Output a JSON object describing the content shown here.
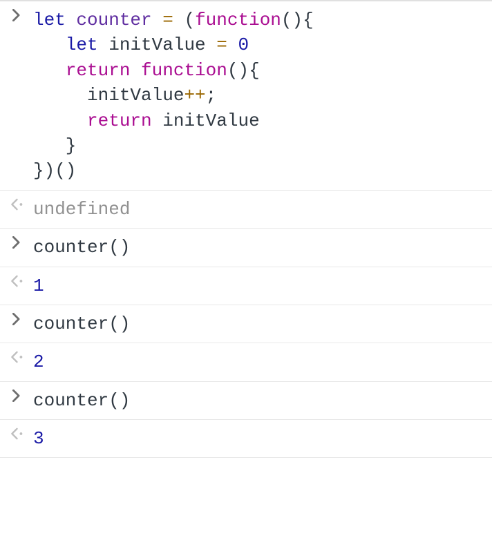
{
  "console": {
    "rows": [
      {
        "type": "input",
        "kind": "code-multiline",
        "tokens": [
          {
            "t": "let",
            "c": "tok-let"
          },
          {
            "t": " ",
            "c": "plain"
          },
          {
            "t": "counter",
            "c": "tok-var"
          },
          {
            "t": " ",
            "c": "plain"
          },
          {
            "t": "=",
            "c": "tok-op"
          },
          {
            "t": " ",
            "c": "plain"
          },
          {
            "t": "(",
            "c": "tok-paren"
          },
          {
            "t": "function",
            "c": "tok-kw"
          },
          {
            "t": "(){",
            "c": "tok-paren"
          },
          {
            "t": "\n   ",
            "c": "plain"
          },
          {
            "t": "let",
            "c": "tok-let"
          },
          {
            "t": " ",
            "c": "plain"
          },
          {
            "t": "initValue",
            "c": "tok-ident"
          },
          {
            "t": " ",
            "c": "plain"
          },
          {
            "t": "=",
            "c": "tok-op"
          },
          {
            "t": " ",
            "c": "plain"
          },
          {
            "t": "0",
            "c": "tok-num"
          },
          {
            "t": "\n   ",
            "c": "plain"
          },
          {
            "t": "return",
            "c": "tok-kw"
          },
          {
            "t": " ",
            "c": "plain"
          },
          {
            "t": "function",
            "c": "tok-kw"
          },
          {
            "t": "(){",
            "c": "tok-paren"
          },
          {
            "t": "\n     ",
            "c": "plain"
          },
          {
            "t": "initValue",
            "c": "tok-ident"
          },
          {
            "t": "++",
            "c": "tok-op"
          },
          {
            "t": ";",
            "c": "tok-punct"
          },
          {
            "t": "\n     ",
            "c": "plain"
          },
          {
            "t": "return",
            "c": "tok-kw"
          },
          {
            "t": " ",
            "c": "plain"
          },
          {
            "t": "initValue",
            "c": "tok-ident"
          },
          {
            "t": "\n   }",
            "c": "tok-paren"
          },
          {
            "t": "\n})()",
            "c": "tok-paren"
          }
        ]
      },
      {
        "type": "output",
        "valueKind": "undefined",
        "text": "undefined"
      },
      {
        "type": "input",
        "kind": "code-inline",
        "text": "counter()"
      },
      {
        "type": "output",
        "valueKind": "number",
        "text": "1"
      },
      {
        "type": "input",
        "kind": "code-inline",
        "text": "counter()"
      },
      {
        "type": "output",
        "valueKind": "number",
        "text": "2"
      },
      {
        "type": "input",
        "kind": "code-inline",
        "text": "counter()"
      },
      {
        "type": "output",
        "valueKind": "number",
        "text": "3"
      }
    ]
  },
  "colors": {
    "promptArrow": "#6e6e6e",
    "resultArrow": "#bfbfbf",
    "resultDot": "#bfbfbf"
  }
}
